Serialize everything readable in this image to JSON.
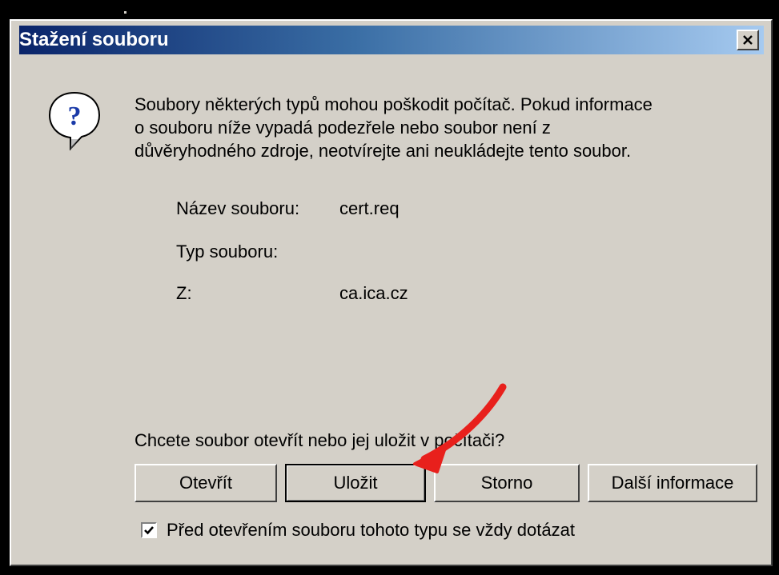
{
  "window": {
    "title": "Stažení souboru",
    "close_label": "x"
  },
  "icon": {
    "name": "question-icon",
    "glyph": "?"
  },
  "warning": {
    "line1": "Soubory některých typů mohou poškodit počítač. Pokud informace",
    "line2": "o souboru níže vypadá podezřele nebo soubor není z",
    "line3": "důvěryhodného zdroje, neotvírejte ani neukládejte tento soubor."
  },
  "file_info": {
    "name_label": "Název souboru:",
    "name_value": "cert.req",
    "type_label": "Typ souboru:",
    "type_value": "",
    "from_label": "Z:",
    "from_value": "ca.ica.cz"
  },
  "question": "Chcete soubor otevřít nebo jej uložit v počítači?",
  "buttons": {
    "open": "Otevřít",
    "save": "Uložit",
    "cancel": "Storno",
    "more_info": "Další informace"
  },
  "checkbox": {
    "label": "Před otevřením souboru tohoto typu se vždy dotázat",
    "checked": true
  },
  "annotation": {
    "arrow_color": "#e8201c"
  },
  "colors": {
    "dialog_bg": "#d4d0c8",
    "titlebar_start": "#0a246a",
    "titlebar_end": "#a6caf0"
  }
}
